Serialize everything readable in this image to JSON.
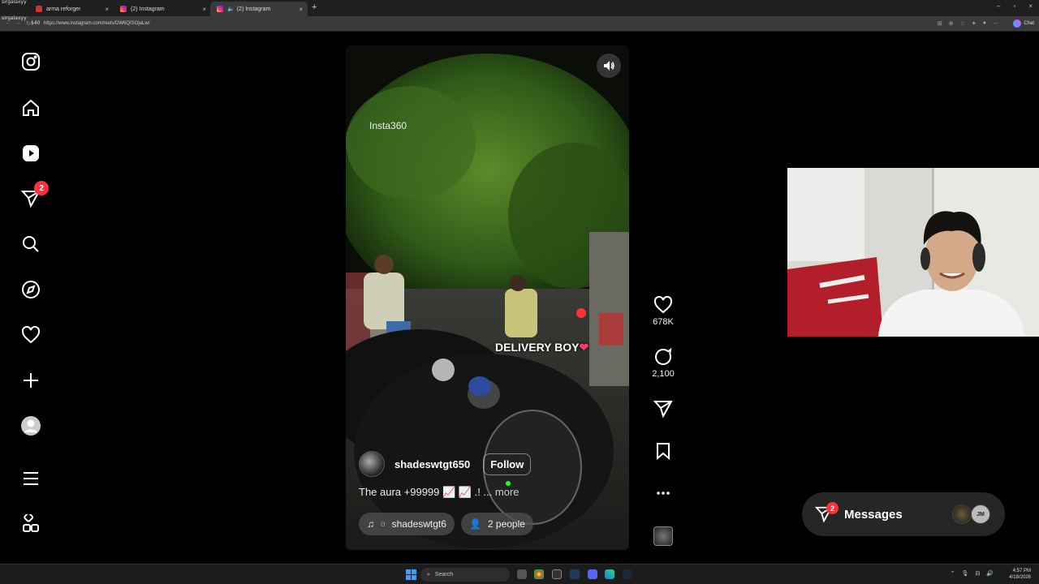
{
  "browser": {
    "overlay_lines": [
      "sirgalaxyy",
      "sirgalaxyy",
      "$40"
    ],
    "tabs": [
      {
        "title": "arma reforger",
        "close": "×"
      },
      {
        "title": "(2) Instagram",
        "close": "×"
      },
      {
        "title": "(2) Instagram",
        "close": "×"
      }
    ],
    "new_tab": "+",
    "window_controls": [
      "–",
      "▫",
      "×"
    ],
    "url": "https://www.instagram.com/reels/DW6QISOjaLw/",
    "chat_label": "Chat"
  },
  "nav": {
    "notifications_badge": "2"
  },
  "reel": {
    "watermark": "Insta360",
    "overlay_caption": "DELIVERY BOY",
    "heart_emoji": "❤",
    "username": "shadeswtgt650",
    "follow_label": "Follow",
    "caption_text": "The aura +99999 📈 📈 .! ...",
    "more_label": "more",
    "audio_label": "shadeswtgt6",
    "audio_prefix": "o",
    "people_label": "2 people"
  },
  "actions": {
    "likes": "678K",
    "comments": "2,100"
  },
  "messages": {
    "label": "Messages",
    "badge": "2",
    "avatar_text": "JM"
  },
  "taskbar": {
    "search_placeholder": "Search",
    "time": "4:57 PM",
    "date": "4/18/2026"
  },
  "colors": {
    "badge": "#ff3040",
    "background": "#000000",
    "panel": "#262626"
  }
}
